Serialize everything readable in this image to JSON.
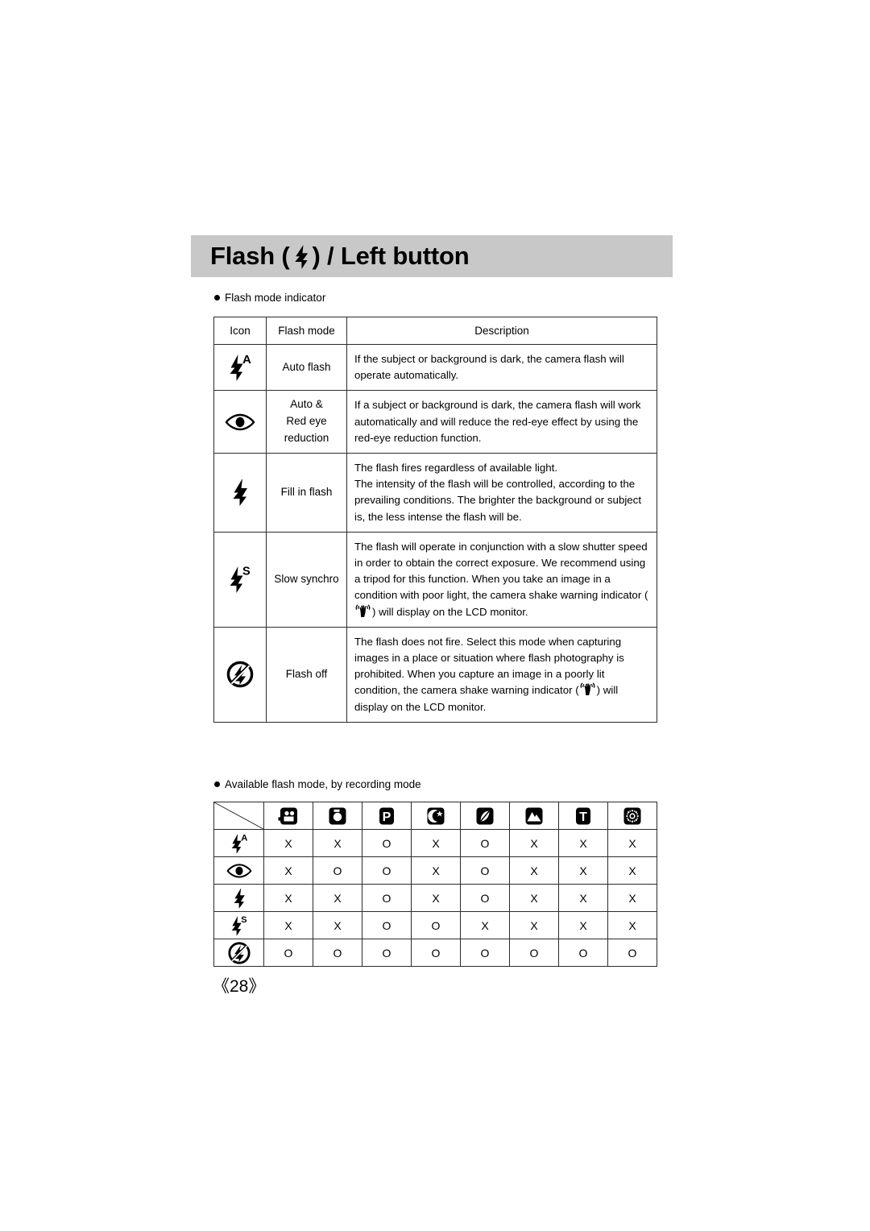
{
  "header": {
    "title_prefix": "Flash (",
    "title_icon": "flash-bolt-icon",
    "title_suffix": ") / Left button"
  },
  "sections": {
    "indicator_heading": "Flash mode indicator",
    "available_heading": "Available flash mode, by recording mode"
  },
  "table_indicator": {
    "headers": {
      "icon": "Icon",
      "mode": "Flash mode",
      "description": "Description"
    },
    "rows": [
      {
        "icon": "flash-auto-icon",
        "mode": "Auto flash",
        "description": "If the subject or background is dark, the camera flash will operate automatically."
      },
      {
        "icon": "red-eye-icon",
        "mode": "Auto &\nRed eye\nreduction",
        "mode_line1": "Auto &",
        "mode_line2": "Red eye",
        "mode_line3": "reduction",
        "description": "If a subject or background is dark, the camera flash will work automatically and will reduce the red-eye effect by using the red-eye reduction function."
      },
      {
        "icon": "flash-fill-icon",
        "mode": "Fill in flash",
        "description_line1": "The flash fires regardless of available light.",
        "description_line2": "The intensity of the flash will be controlled, according to the prevailing conditions. The brighter the background or subject is, the less intense the flash will be."
      },
      {
        "icon": "flash-slow-sync-icon",
        "mode": "Slow synchro",
        "description_part1": "The flash will operate in conjunction with a slow shutter speed in order to obtain the correct exposure. We recommend using a tripod for this function. When you take an image in a condition with poor light, the camera shake warning indicator (",
        "description_inline_icon": "camera-shake-warning-icon",
        "description_part2": ") will display on the LCD monitor."
      },
      {
        "icon": "flash-off-icon",
        "mode": "Flash off",
        "description_part1": "The flash does not fire. Select this mode when capturing images in a place or situation where flash photography is prohibited. When you capture an image in a poorly lit condition, the camera shake warning indicator (",
        "description_inline_icon": "camera-shake-warning-icon",
        "description_part2": ") will display on the LCD monitor."
      }
    ]
  },
  "table_availability": {
    "column_icons": [
      "movie-mode-icon",
      "auto-mode-icon",
      "program-mode-icon",
      "night-mode-icon",
      "portrait-mode-icon",
      "landscape-mode-icon",
      "text-mode-icon",
      "fireworks-mode-icon"
    ],
    "row_icons": [
      "flash-auto-icon",
      "red-eye-icon",
      "flash-fill-icon",
      "flash-slow-sync-icon",
      "flash-off-icon"
    ],
    "matrix": [
      [
        "X",
        "X",
        "O",
        "X",
        "O",
        "X",
        "X",
        "X"
      ],
      [
        "X",
        "O",
        "O",
        "X",
        "O",
        "X",
        "X",
        "X"
      ],
      [
        "X",
        "X",
        "O",
        "X",
        "O",
        "X",
        "X",
        "X"
      ],
      [
        "X",
        "X",
        "O",
        "O",
        "X",
        "X",
        "X",
        "X"
      ],
      [
        "O",
        "O",
        "O",
        "O",
        "O",
        "O",
        "O",
        "O"
      ]
    ]
  },
  "footer": {
    "page_number": "《28》"
  },
  "colors": {
    "header_band": "#c8c8c8",
    "border": "#2b2b2b",
    "text": "#000000",
    "background": "#ffffff"
  }
}
